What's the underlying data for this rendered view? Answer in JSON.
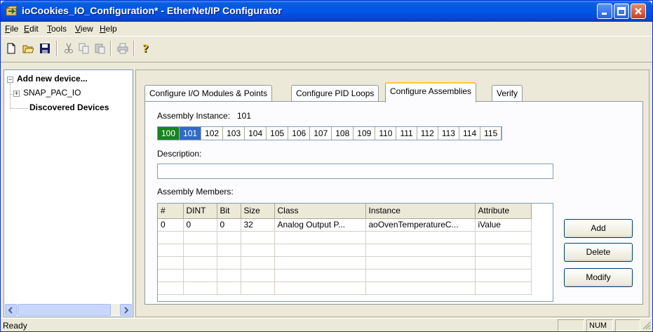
{
  "window": {
    "title": "ioCookies_IO_Configuration* - EtherNet/IP Configurator"
  },
  "menu": [
    {
      "label": "File",
      "u": "F",
      "rest": "ile"
    },
    {
      "label": "Edit",
      "u": "E",
      "rest": "dit"
    },
    {
      "label": "Tools",
      "u": "T",
      "rest": "ools"
    },
    {
      "label": "View",
      "u": "V",
      "rest": "iew"
    },
    {
      "label": "Help",
      "u": "H",
      "rest": "elp"
    }
  ],
  "toolbar": {
    "icons": [
      "new-file-icon",
      "open-folder-icon",
      "save-icon",
      "cut-icon",
      "copy-icon",
      "paste-icon",
      "print-icon",
      "help-icon"
    ]
  },
  "tree": {
    "root_label": "Add new device...",
    "child_label": "SNAP_PAC_IO",
    "discovered_label": "Discovered Devices"
  },
  "tabs": [
    {
      "label": "Configure I/O Modules & Points",
      "active": false
    },
    {
      "label": "Configure PID Loops",
      "active": false
    },
    {
      "label": "Configure Assemblies",
      "active": true
    },
    {
      "label": "Verify",
      "active": false
    }
  ],
  "assembly": {
    "instance_label": "Assembly Instance:",
    "instance_value": "101",
    "instances": [
      "100",
      "101",
      "102",
      "103",
      "104",
      "105",
      "106",
      "107",
      "108",
      "109",
      "110",
      "111",
      "112",
      "113",
      "114",
      "115"
    ],
    "instance_used": "100",
    "instance_selected": "101",
    "description_label": "Description:",
    "description_value": "",
    "members_label": "Assembly Members:"
  },
  "members_table": {
    "columns": [
      "#",
      "DINT",
      "Bit",
      "Size",
      "Class",
      "Instance",
      "Attribute"
    ],
    "rows": [
      [
        "0",
        "0",
        "0",
        "32",
        "Analog Output P...",
        "aoOvenTemperatureC...",
        "iValue"
      ]
    ]
  },
  "buttons": {
    "add": "Add",
    "delete": "Delete",
    "modify": "Modify"
  },
  "status": {
    "text": "Ready",
    "num": "NUM"
  },
  "colors": {
    "titlebar": "#0055e5",
    "used_instance": "#18841f",
    "selected_instance": "#316ac5",
    "active_tab_highlight": "#ffc83c"
  }
}
